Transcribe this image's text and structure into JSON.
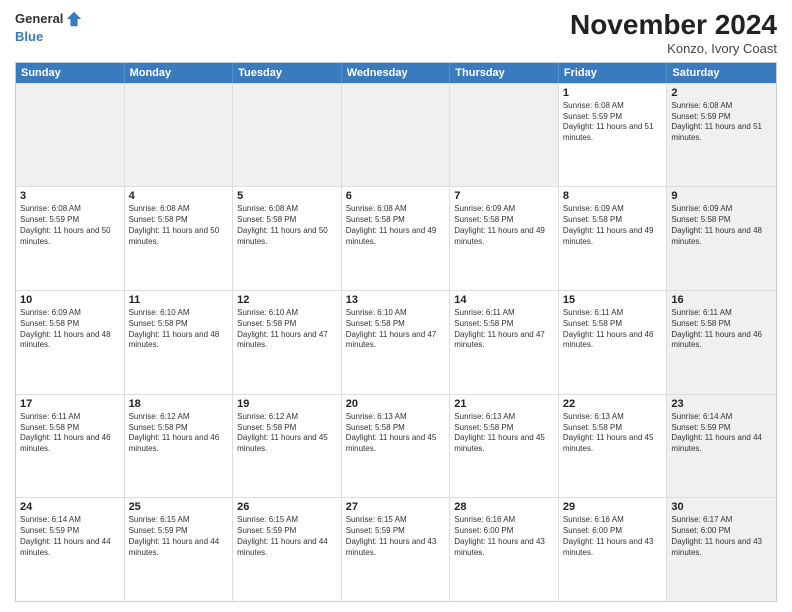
{
  "header": {
    "logo_line1": "General",
    "logo_line2": "Blue",
    "month_title": "November 2024",
    "location": "Konzo, Ivory Coast"
  },
  "days_of_week": [
    "Sunday",
    "Monday",
    "Tuesday",
    "Wednesday",
    "Thursday",
    "Friday",
    "Saturday"
  ],
  "weeks": [
    [
      {
        "day": "",
        "info": "",
        "shaded": true
      },
      {
        "day": "",
        "info": "",
        "shaded": true
      },
      {
        "day": "",
        "info": "",
        "shaded": true
      },
      {
        "day": "",
        "info": "",
        "shaded": true
      },
      {
        "day": "",
        "info": "",
        "shaded": true
      },
      {
        "day": "1",
        "info": "Sunrise: 6:08 AM\nSunset: 5:59 PM\nDaylight: 11 hours and 51 minutes.",
        "shaded": false
      },
      {
        "day": "2",
        "info": "Sunrise: 6:08 AM\nSunset: 5:59 PM\nDaylight: 11 hours and 51 minutes.",
        "shaded": true
      }
    ],
    [
      {
        "day": "3",
        "info": "Sunrise: 6:08 AM\nSunset: 5:59 PM\nDaylight: 11 hours and 50 minutes.",
        "shaded": false
      },
      {
        "day": "4",
        "info": "Sunrise: 6:08 AM\nSunset: 5:58 PM\nDaylight: 11 hours and 50 minutes.",
        "shaded": false
      },
      {
        "day": "5",
        "info": "Sunrise: 6:08 AM\nSunset: 5:58 PM\nDaylight: 11 hours and 50 minutes.",
        "shaded": false
      },
      {
        "day": "6",
        "info": "Sunrise: 6:08 AM\nSunset: 5:58 PM\nDaylight: 11 hours and 49 minutes.",
        "shaded": false
      },
      {
        "day": "7",
        "info": "Sunrise: 6:09 AM\nSunset: 5:58 PM\nDaylight: 11 hours and 49 minutes.",
        "shaded": false
      },
      {
        "day": "8",
        "info": "Sunrise: 6:09 AM\nSunset: 5:58 PM\nDaylight: 11 hours and 49 minutes.",
        "shaded": false
      },
      {
        "day": "9",
        "info": "Sunrise: 6:09 AM\nSunset: 5:58 PM\nDaylight: 11 hours and 48 minutes.",
        "shaded": true
      }
    ],
    [
      {
        "day": "10",
        "info": "Sunrise: 6:09 AM\nSunset: 5:58 PM\nDaylight: 11 hours and 48 minutes.",
        "shaded": false
      },
      {
        "day": "11",
        "info": "Sunrise: 6:10 AM\nSunset: 5:58 PM\nDaylight: 11 hours and 48 minutes.",
        "shaded": false
      },
      {
        "day": "12",
        "info": "Sunrise: 6:10 AM\nSunset: 5:58 PM\nDaylight: 11 hours and 47 minutes.",
        "shaded": false
      },
      {
        "day": "13",
        "info": "Sunrise: 6:10 AM\nSunset: 5:58 PM\nDaylight: 11 hours and 47 minutes.",
        "shaded": false
      },
      {
        "day": "14",
        "info": "Sunrise: 6:11 AM\nSunset: 5:58 PM\nDaylight: 11 hours and 47 minutes.",
        "shaded": false
      },
      {
        "day": "15",
        "info": "Sunrise: 6:11 AM\nSunset: 5:58 PM\nDaylight: 11 hours and 46 minutes.",
        "shaded": false
      },
      {
        "day": "16",
        "info": "Sunrise: 6:11 AM\nSunset: 5:58 PM\nDaylight: 11 hours and 46 minutes.",
        "shaded": true
      }
    ],
    [
      {
        "day": "17",
        "info": "Sunrise: 6:11 AM\nSunset: 5:58 PM\nDaylight: 11 hours and 46 minutes.",
        "shaded": false
      },
      {
        "day": "18",
        "info": "Sunrise: 6:12 AM\nSunset: 5:58 PM\nDaylight: 11 hours and 46 minutes.",
        "shaded": false
      },
      {
        "day": "19",
        "info": "Sunrise: 6:12 AM\nSunset: 5:58 PM\nDaylight: 11 hours and 45 minutes.",
        "shaded": false
      },
      {
        "day": "20",
        "info": "Sunrise: 6:13 AM\nSunset: 5:58 PM\nDaylight: 11 hours and 45 minutes.",
        "shaded": false
      },
      {
        "day": "21",
        "info": "Sunrise: 6:13 AM\nSunset: 5:58 PM\nDaylight: 11 hours and 45 minutes.",
        "shaded": false
      },
      {
        "day": "22",
        "info": "Sunrise: 6:13 AM\nSunset: 5:58 PM\nDaylight: 11 hours and 45 minutes.",
        "shaded": false
      },
      {
        "day": "23",
        "info": "Sunrise: 6:14 AM\nSunset: 5:59 PM\nDaylight: 11 hours and 44 minutes.",
        "shaded": true
      }
    ],
    [
      {
        "day": "24",
        "info": "Sunrise: 6:14 AM\nSunset: 5:59 PM\nDaylight: 11 hours and 44 minutes.",
        "shaded": false
      },
      {
        "day": "25",
        "info": "Sunrise: 6:15 AM\nSunset: 5:59 PM\nDaylight: 11 hours and 44 minutes.",
        "shaded": false
      },
      {
        "day": "26",
        "info": "Sunrise: 6:15 AM\nSunset: 5:59 PM\nDaylight: 11 hours and 44 minutes.",
        "shaded": false
      },
      {
        "day": "27",
        "info": "Sunrise: 6:15 AM\nSunset: 5:59 PM\nDaylight: 11 hours and 43 minutes.",
        "shaded": false
      },
      {
        "day": "28",
        "info": "Sunrise: 6:16 AM\nSunset: 6:00 PM\nDaylight: 11 hours and 43 minutes.",
        "shaded": false
      },
      {
        "day": "29",
        "info": "Sunrise: 6:16 AM\nSunset: 6:00 PM\nDaylight: 11 hours and 43 minutes.",
        "shaded": false
      },
      {
        "day": "30",
        "info": "Sunrise: 6:17 AM\nSunset: 6:00 PM\nDaylight: 11 hours and 43 minutes.",
        "shaded": true
      }
    ]
  ]
}
